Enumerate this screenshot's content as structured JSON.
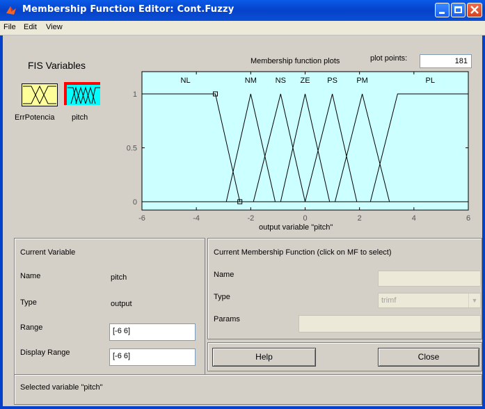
{
  "window": {
    "title": "Membership Function Editor: Cont.Fuzzy"
  },
  "menu": [
    "File",
    "Edit",
    "View"
  ],
  "fis": {
    "heading": "FIS Variables",
    "variables": [
      {
        "label": "ErrPotencia",
        "selected": false,
        "color": "#ffff99"
      },
      {
        "label": "pitch",
        "selected": true,
        "color": "#00ffff"
      }
    ]
  },
  "plot": {
    "header": "Membership function plots",
    "plot_points_label": "plot points:",
    "plot_points_value": "181",
    "xlabel": "output variable \"pitch\"",
    "background": "#ccffff"
  },
  "chart_data": {
    "type": "line",
    "xlim": [
      -6,
      6
    ],
    "ylim": [
      0,
      1
    ],
    "xticks": [
      -6,
      -4,
      -2,
      0,
      2,
      4,
      6
    ],
    "yticks": [
      0,
      0.5,
      1
    ],
    "xlabel": "output variable \"pitch\"",
    "series": [
      {
        "name": "NL",
        "points": [
          [
            -6,
            1
          ],
          [
            -3.3,
            1
          ],
          [
            -2.4,
            0
          ],
          [
            6,
            0
          ]
        ]
      },
      {
        "name": "NM",
        "points": [
          [
            -6,
            0
          ],
          [
            -2.9,
            0
          ],
          [
            -2,
            1
          ],
          [
            -1.1,
            0
          ],
          [
            6,
            0
          ]
        ]
      },
      {
        "name": "NS",
        "points": [
          [
            -6,
            0
          ],
          [
            -1.9,
            0
          ],
          [
            -0.9,
            1
          ],
          [
            0,
            0
          ],
          [
            6,
            0
          ]
        ]
      },
      {
        "name": "ZE",
        "points": [
          [
            -6,
            0
          ],
          [
            -0.9,
            0
          ],
          [
            0,
            1
          ],
          [
            0.9,
            0
          ],
          [
            6,
            0
          ]
        ]
      },
      {
        "name": "PS",
        "points": [
          [
            -6,
            0
          ],
          [
            0,
            0
          ],
          [
            1,
            1
          ],
          [
            1.9,
            0
          ],
          [
            6,
            0
          ]
        ]
      },
      {
        "name": "PM",
        "points": [
          [
            -6,
            0
          ],
          [
            1.1,
            0
          ],
          [
            2.1,
            1
          ],
          [
            3.1,
            0
          ],
          [
            6,
            0
          ]
        ]
      },
      {
        "name": "PL",
        "points": [
          [
            -6,
            0
          ],
          [
            2.4,
            0
          ],
          [
            3.4,
            1
          ],
          [
            6,
            1
          ]
        ]
      }
    ],
    "labels": [
      {
        "text": "NL",
        "x": -4.4
      },
      {
        "text": "NM",
        "x": -2.0
      },
      {
        "text": "NS",
        "x": -0.9
      },
      {
        "text": "ZE",
        "x": 0.0
      },
      {
        "text": "PS",
        "x": 1.0
      },
      {
        "text": "PM",
        "x": 2.1
      },
      {
        "text": "PL",
        "x": 4.6
      }
    ],
    "markers": [
      [
        -3.3,
        1
      ],
      [
        -2.4,
        0
      ]
    ]
  },
  "current_variable": {
    "heading": "Current Variable",
    "name_label": "Name",
    "name_value": "pitch",
    "type_label": "Type",
    "type_value": "output",
    "range_label": "Range",
    "range_value": "[-6 6]",
    "display_range_label": "Display Range",
    "display_range_value": "[-6 6]"
  },
  "current_mf": {
    "heading": "Current Membership Function (click on MF to select)",
    "name_label": "Name",
    "type_label": "Type",
    "type_value": "trimf",
    "params_label": "Params"
  },
  "buttons": {
    "help": "Help",
    "close": "Close"
  },
  "status": "Selected variable \"pitch\""
}
